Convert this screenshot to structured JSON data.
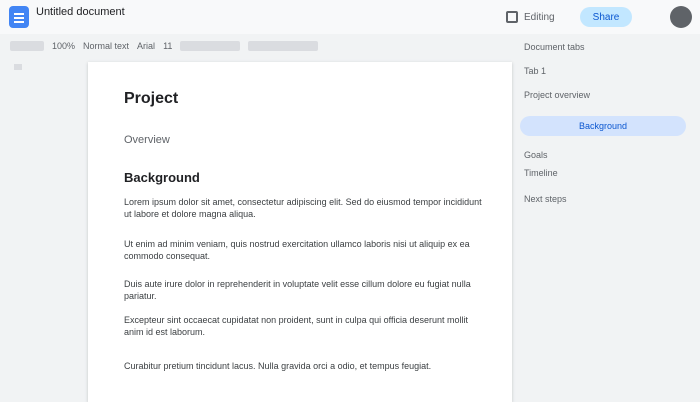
{
  "header": {
    "doc_title": "Untitled document",
    "mode_label": "Editing",
    "share_label": "Share"
  },
  "toolbar": {
    "zoom": "100%",
    "style": "Normal text",
    "font": "Arial",
    "font_size": "11"
  },
  "document": {
    "title": "Project",
    "subtitle": "Overview",
    "section_heading": "Background",
    "paragraphs": [
      "Lorem ipsum dolor sit amet, consectetur adipiscing elit. Sed do eiusmod tempor incididunt ut labore et dolore magna aliqua.",
      "Ut enim ad minim veniam, quis nostrud exercitation ullamco laboris nisi ut aliquip ex ea commodo consequat.",
      "Duis aute irure dolor in reprehenderit in voluptate velit esse cillum dolore eu fugiat nulla pariatur.",
      "Excepteur sint occaecat cupidatat non proident, sunt in culpa qui officia deserunt mollit anim id est laborum.",
      "Curabitur pretium tincidunt lacus. Nulla gravida orci a odio, et tempus feugiat."
    ]
  },
  "outline": {
    "heading": "Document tabs",
    "items": [
      {
        "label": "Tab 1"
      },
      {
        "label": "Project overview"
      },
      {
        "label": "Background"
      },
      {
        "label": "Goals"
      },
      {
        "label": "Timeline"
      },
      {
        "label": "Next steps"
      }
    ]
  }
}
